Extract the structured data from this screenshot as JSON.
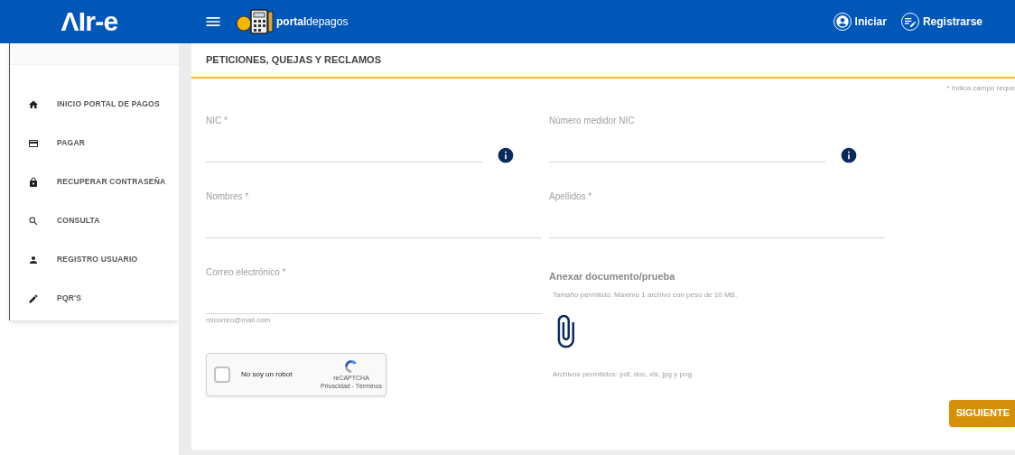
{
  "header": {
    "logo": "ΛIr-e",
    "brand_bold": "portal",
    "brand_rest": "depagos",
    "actions": [
      {
        "label": "Iniciar",
        "kind": "user"
      },
      {
        "label": "Registrarse",
        "kind": "register"
      }
    ]
  },
  "sidebar": {
    "items": [
      {
        "label": "INICIO PORTAL DE PAGOS"
      },
      {
        "label": "PAGAR"
      },
      {
        "label": "RECUPERAR CONTRASEÑA"
      },
      {
        "label": "CONSULTA"
      },
      {
        "label": "REGISTRO USUARIO"
      },
      {
        "label": "PQR'S"
      }
    ]
  },
  "page": {
    "title": "PETICIONES, QUEJAS Y RECLAMOS",
    "required_note": "* Indica campo reque",
    "left_fields": [
      {
        "label": "NIC *",
        "info": true
      },
      {
        "label": "Nombres *",
        "info": false
      },
      {
        "label": "Correo electrónico *",
        "info": false,
        "hint": "micorreo@mail.com"
      }
    ],
    "right_fields": [
      {
        "label": "Número medidor NIC",
        "info": true
      },
      {
        "label": "Apellidos *",
        "info": false
      }
    ],
    "captcha": {
      "label": "No soy un robot",
      "checked": false,
      "brand": "reCAPTCHA",
      "links": "Privacidad - Términos"
    },
    "attach": {
      "title": "Anexar documento/prueba",
      "size_note": "Tamaño permitido: Máximo 1 archivo con peso de 10 MB.",
      "types_note": "Archivos permitidos: pdf, doc, xls, jpg y png."
    },
    "next_button": "SIGUIENTE"
  }
}
